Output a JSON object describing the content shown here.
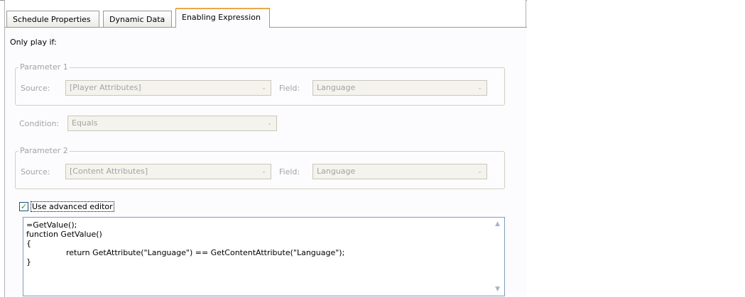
{
  "tabs": [
    {
      "label": "Schedule Properties"
    },
    {
      "label": "Dynamic Data"
    },
    {
      "label": "Enabling Expression"
    }
  ],
  "active_tab": "Enabling Expression",
  "only_play_if_label": "Only play if:",
  "parameter1": {
    "title": "Parameter 1",
    "source_label": "Source:",
    "source_value": "[Player Attributes]",
    "field_label": "Field:",
    "field_value": "Language"
  },
  "condition": {
    "label": "Condition:",
    "value": "Equals"
  },
  "parameter2": {
    "title": "Parameter 2",
    "source_label": "Source:",
    "source_value": "[Content Attributes]",
    "field_label": "Field:",
    "field_value": "Language"
  },
  "advanced_editor": {
    "label": "Use advanced editor",
    "checked": true,
    "check_glyph": "✓"
  },
  "editor": {
    "code": "=GetValue();\nfunction GetValue()\n{\n\t\treturn GetAttribute(\"Language\") == GetContentAttribute(\"Language\");\n}",
    "scroll_up_glyph": "▲",
    "scroll_down_glyph": "▼"
  },
  "icons": {
    "dropdown_arrow": "⌄"
  }
}
